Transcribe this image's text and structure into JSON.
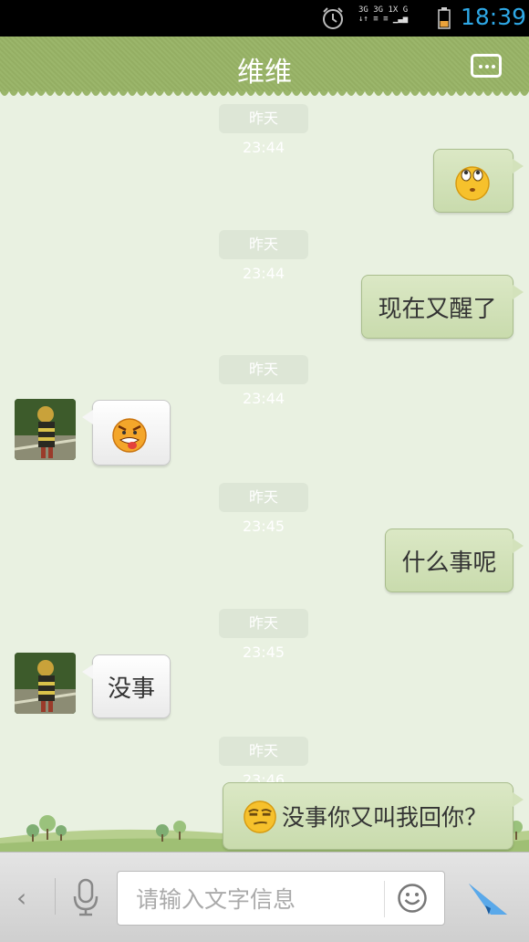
{
  "status_bar": {
    "time": "18:39",
    "network_top": "3G 3G 1X G",
    "network_bottom": "↓↑ ≡ ≡ ▁▃▅",
    "icons": [
      "alarm-icon",
      "signal-icon",
      "battery-icon"
    ]
  },
  "header": {
    "title": "维维",
    "menu_icon": "more-icon"
  },
  "messages": [
    {
      "timestamp": "昨天 23:44",
      "side": "right",
      "type": "emoji",
      "emoji": "rolling-eyes-emoji"
    },
    {
      "timestamp": "昨天 23:44",
      "side": "right",
      "type": "text",
      "text": "现在又醒了"
    },
    {
      "timestamp": "昨天 23:44",
      "side": "left",
      "type": "emoji",
      "emoji": "angry-tongue-emoji"
    },
    {
      "timestamp": "昨天 23:45",
      "side": "right",
      "type": "text",
      "text": "什么事呢"
    },
    {
      "timestamp": "昨天 23:45",
      "side": "left",
      "type": "text",
      "text": "没事"
    },
    {
      "timestamp": "昨天 23:46",
      "side": "right",
      "type": "text_with_emoji",
      "emoji": "smirk-emoji",
      "text": "没事你又叫我回你？"
    }
  ],
  "input_bar": {
    "back_glyph": "‹",
    "placeholder": "请输入文字信息",
    "icons": [
      "back-icon",
      "microphone-icon",
      "smiley-icon",
      "send-icon"
    ]
  },
  "colors": {
    "header_green": "#9ab56a",
    "chat_bg": "#e9f1e1",
    "clock_blue": "#2ea8e6",
    "send_blue": "#2a7fd0"
  }
}
